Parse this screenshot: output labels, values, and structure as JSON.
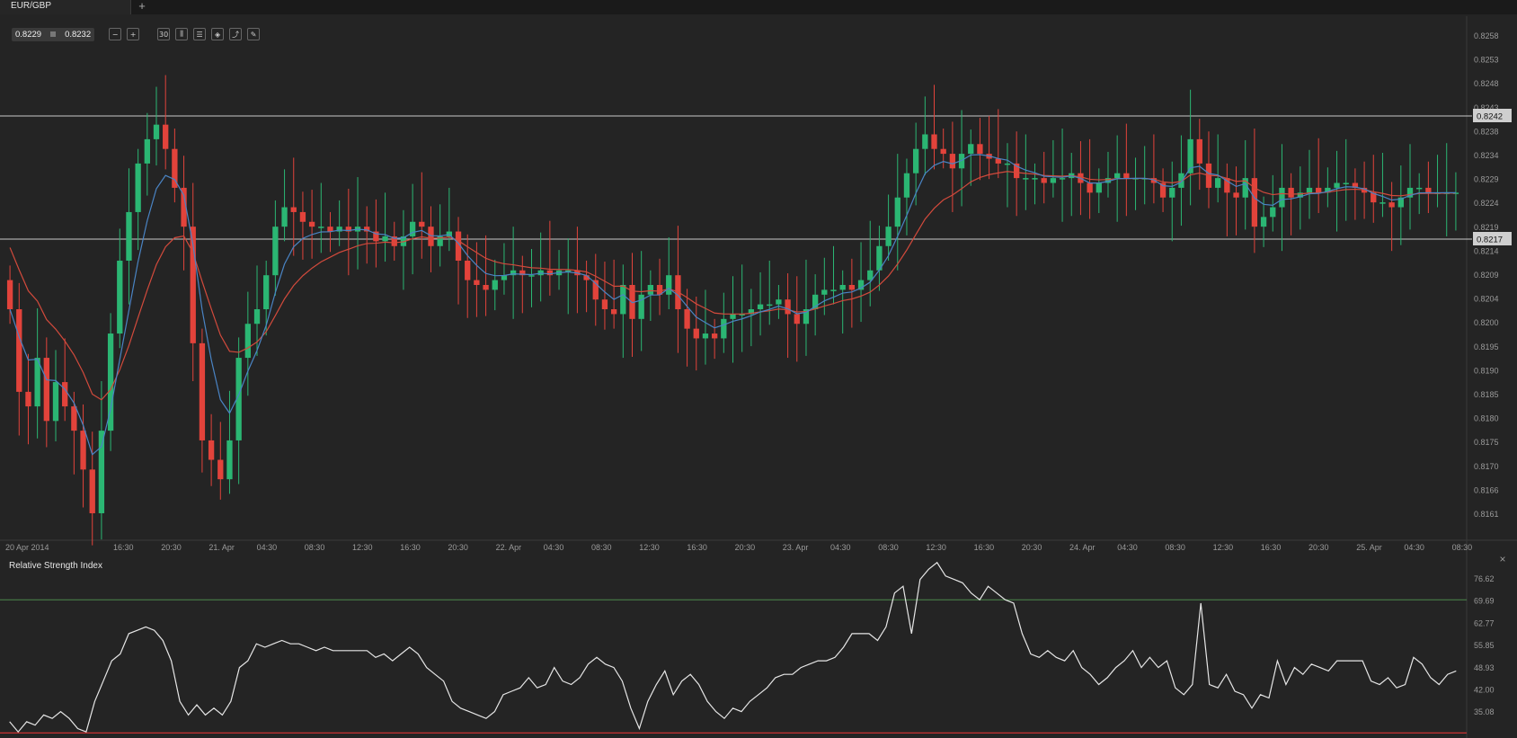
{
  "tab": {
    "symbol": "EUR/GBP",
    "add_label": "+"
  },
  "quote": {
    "bid": "0.8229",
    "ask": "0.8232"
  },
  "toolbar": {
    "zoom_out": "−",
    "zoom_in": "+",
    "timeframe": "30",
    "candles": "⫼",
    "indicators": "☰",
    "objects": "◈",
    "overlay": "⤴",
    "draw": "✎"
  },
  "colors": {
    "bull": "#2bb673",
    "bear": "#e2433b",
    "ema_fast": "#4a84c4",
    "ema_slow": "#d24a3c",
    "rsi_line": "#e6e6e6",
    "rsi_upper": "#4d8a4d",
    "rsi_lower": "#c83232",
    "level_line": "#c8c8c8"
  },
  "chart_data": [
    {
      "type": "candlestick",
      "symbol": "EUR/GBP",
      "timeframe": "30 min",
      "ylim": [
        0.8158,
        0.8262
      ],
      "y_ticks": [
        "0.8258",
        "0.8253",
        "0.8248",
        "0.8243",
        "0.8238",
        "0.8234",
        "0.8229",
        "0.8224",
        "0.8219",
        "0.8214",
        "0.8209",
        "0.8204",
        "0.8200",
        "0.8195",
        "0.8190",
        "0.8185",
        "0.8180",
        "0.8175",
        "0.8170",
        "0.8166",
        "0.8161"
      ],
      "x_ticks": [
        "20 Apr 2014",
        "16:30",
        "20:30",
        "21. Apr",
        "04:30",
        "08:30",
        "12:30",
        "16:30",
        "20:30",
        "22. Apr",
        "04:30",
        "08:30",
        "12:30",
        "16:30",
        "20:30",
        "23. Apr",
        "04:30",
        "08:30",
        "12:30",
        "16:30",
        "20:30",
        "24. Apr",
        "04:30",
        "08:30",
        "12:30",
        "16:30",
        "20:30",
        "25. Apr",
        "04:30",
        "08:30"
      ],
      "levels": [
        {
          "label": "0.8242",
          "value": 0.8242
        },
        {
          "label": "0.8217",
          "value": 0.8217
        }
      ],
      "closes": [
        0.8205,
        0.8188,
        0.8185,
        0.8195,
        0.8182,
        0.819,
        0.8185,
        0.818,
        0.8172,
        0.8163,
        0.818,
        0.82,
        0.8215,
        0.8225,
        0.8235,
        0.824,
        0.8243,
        0.8238,
        0.823,
        0.8222,
        0.8198,
        0.8178,
        0.8174,
        0.817,
        0.8178,
        0.8195,
        0.8202,
        0.8205,
        0.8212,
        0.8222,
        0.8226,
        0.8225,
        0.8223,
        0.8222,
        0.8222,
        0.8221,
        0.8222,
        0.8221,
        0.8222,
        0.8221,
        0.8219,
        0.822,
        0.8218,
        0.822,
        0.8223,
        0.8222,
        0.8218,
        0.822,
        0.8221,
        0.8215,
        0.8211,
        0.821,
        0.8209,
        0.8211,
        0.8212,
        0.8213,
        0.8212,
        0.8212,
        0.8213,
        0.8212,
        0.8213,
        0.8213,
        0.8212,
        0.8211,
        0.8207,
        0.8205,
        0.8204,
        0.821,
        0.8203,
        0.8208,
        0.821,
        0.8208,
        0.8212,
        0.8205,
        0.8201,
        0.8199,
        0.82,
        0.8199,
        0.8203,
        0.8204,
        0.8204,
        0.8205,
        0.8206,
        0.8206,
        0.8207,
        0.8204,
        0.8202,
        0.8205,
        0.8208,
        0.8209,
        0.8209,
        0.821,
        0.8209,
        0.8211,
        0.8213,
        0.8218,
        0.8222,
        0.8228,
        0.8233,
        0.8238,
        0.8241,
        0.8238,
        0.8237,
        0.8234,
        0.8237,
        0.8239,
        0.8237,
        0.8236,
        0.8235,
        0.8235,
        0.8232,
        0.8232,
        0.8232,
        0.8231,
        0.8232,
        0.8232,
        0.8233,
        0.8231,
        0.8229,
        0.8231,
        0.8232,
        0.8233,
        0.8232,
        0.8232,
        0.8232,
        0.8231,
        0.8228,
        0.823,
        0.8233,
        0.824,
        0.8235,
        0.823,
        0.8232,
        0.8229,
        0.8228,
        0.8232,
        0.8222,
        0.8224,
        0.8226,
        0.823,
        0.8228,
        0.8229,
        0.823,
        0.8229,
        0.823,
        0.8231,
        0.8231,
        0.823,
        0.8229,
        0.8227,
        0.8227,
        0.8226,
        0.8228,
        0.823,
        0.823,
        0.8229,
        0.8229,
        0.8229,
        0.8229
      ]
    },
    {
      "type": "line",
      "title": "Relative Strength Index",
      "ylim": [
        30,
        82
      ],
      "y_ticks": [
        "76.62",
        "69.69",
        "62.77",
        "55.85",
        "48.93",
        "42.00",
        "35.08"
      ],
      "upper_level": 70,
      "lower_level": 30.7,
      "values": [
        34,
        31,
        34,
        33,
        36,
        35,
        37,
        35,
        32,
        31,
        40,
        46,
        52,
        54,
        60,
        61,
        62,
        61,
        58,
        52,
        40,
        36,
        39,
        36,
        38,
        36,
        40,
        50,
        52,
        57,
        56,
        57,
        58,
        57,
        57,
        56,
        55,
        56,
        55,
        55,
        55,
        55,
        55,
        53,
        54,
        52,
        54,
        56,
        54,
        50,
        48,
        46,
        40,
        38,
        37,
        36,
        35,
        37,
        42,
        43,
        44,
        47,
        44,
        45,
        50,
        46,
        45,
        47,
        51,
        53,
        51,
        50,
        46,
        38,
        32,
        40,
        45,
        49,
        42,
        46,
        48,
        45,
        40,
        37,
        35,
        38,
        37,
        40,
        42,
        44,
        47,
        48,
        48,
        50,
        51,
        52,
        52,
        53,
        56,
        60,
        60,
        60,
        58,
        62,
        72,
        74,
        60,
        76,
        79,
        81,
        77,
        76,
        75,
        72,
        70,
        74,
        72,
        70,
        69,
        60,
        54,
        53,
        55,
        53,
        52,
        55,
        50,
        48,
        45,
        47,
        50,
        52,
        55,
        50,
        53,
        50,
        52,
        44,
        42,
        45,
        69,
        45,
        44,
        48,
        43,
        42,
        38,
        42,
        41,
        52,
        45,
        50,
        48,
        51,
        50,
        49,
        52,
        52,
        52,
        52,
        46,
        45,
        47,
        44,
        45,
        53,
        51,
        47,
        45,
        48,
        49
      ]
    }
  ]
}
